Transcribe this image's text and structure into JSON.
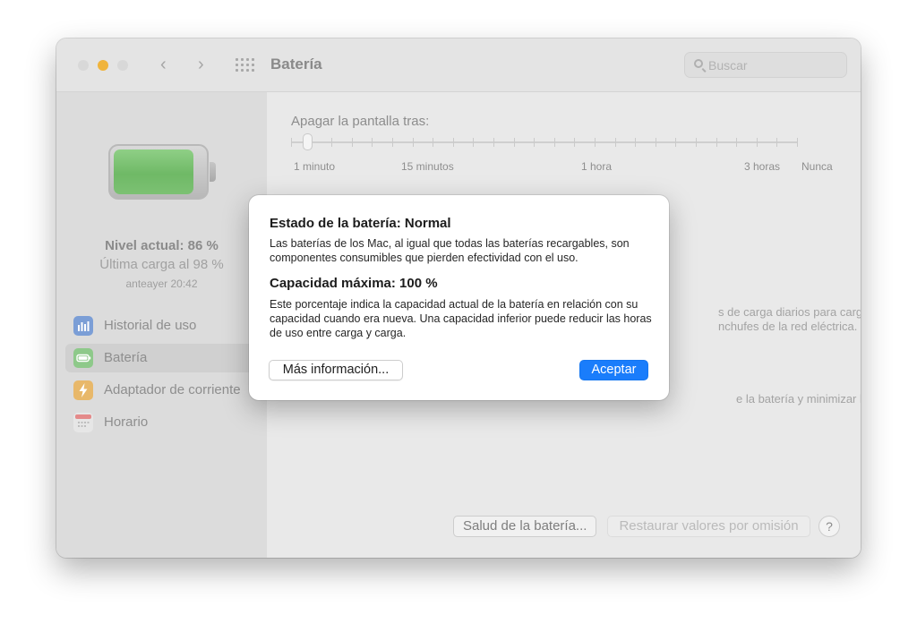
{
  "window": {
    "title": "Batería",
    "search_placeholder": "Buscar",
    "nav": {
      "back_glyph": "‹",
      "forward_glyph": "›"
    }
  },
  "colors": {
    "battery_green": "#6fb966",
    "traffic_minimize": "#f0b43c",
    "accent_blue": "#1a7dfb"
  },
  "sidebar": {
    "battery_level_percent": 86,
    "level_text": "Nivel actual: 86 %",
    "last_charge_text": "Última carga al 98 %",
    "last_charge_time": "anteayer 20:42",
    "items": [
      {
        "label": "Historial de uso",
        "icon": "chart-icon",
        "color": "#7b9ed6",
        "selected": false
      },
      {
        "label": "Batería",
        "icon": "battery-icon",
        "color": "#8ec98a",
        "selected": true
      },
      {
        "label": "Adaptador de corriente",
        "icon": "bolt-icon",
        "color": "#e8b86a",
        "selected": false
      },
      {
        "label": "Horario",
        "icon": "calendar-icon",
        "color": "#e6e6e6",
        "selected": false
      }
    ]
  },
  "content": {
    "slider_label": "Apagar la pantalla tras:",
    "slider_ticks": [
      "1 minuto",
      "15 minutos",
      "1 hora",
      "3 horas",
      "Nunca"
    ],
    "partial_text_1_line1": "s de carga diarios para cargar",
    "partial_text_1_line2": "nchufes de la red eléctrica.",
    "partial_text_2": "e la batería y minimizar los",
    "battery_health_button": "Salud de la batería...",
    "restore_defaults_button": "Restaurar valores por omisión",
    "help_label": "?"
  },
  "dialog": {
    "status_title": "Estado de la batería: Normal",
    "status_text": "Las baterías de los Mac, al igual que todas las baterías recargables, son componentes consumibles que pierden efectividad con el uso.",
    "capacity_title": "Capacidad máxima: 100 %",
    "capacity_text": "Este porcentaje indica la capacidad actual de la batería en relación con su capacidad cuando era nueva. Una capacidad inferior puede reducir las horas de uso entre carga y carga.",
    "more_info_button": "Más información...",
    "ok_button": "Aceptar"
  }
}
